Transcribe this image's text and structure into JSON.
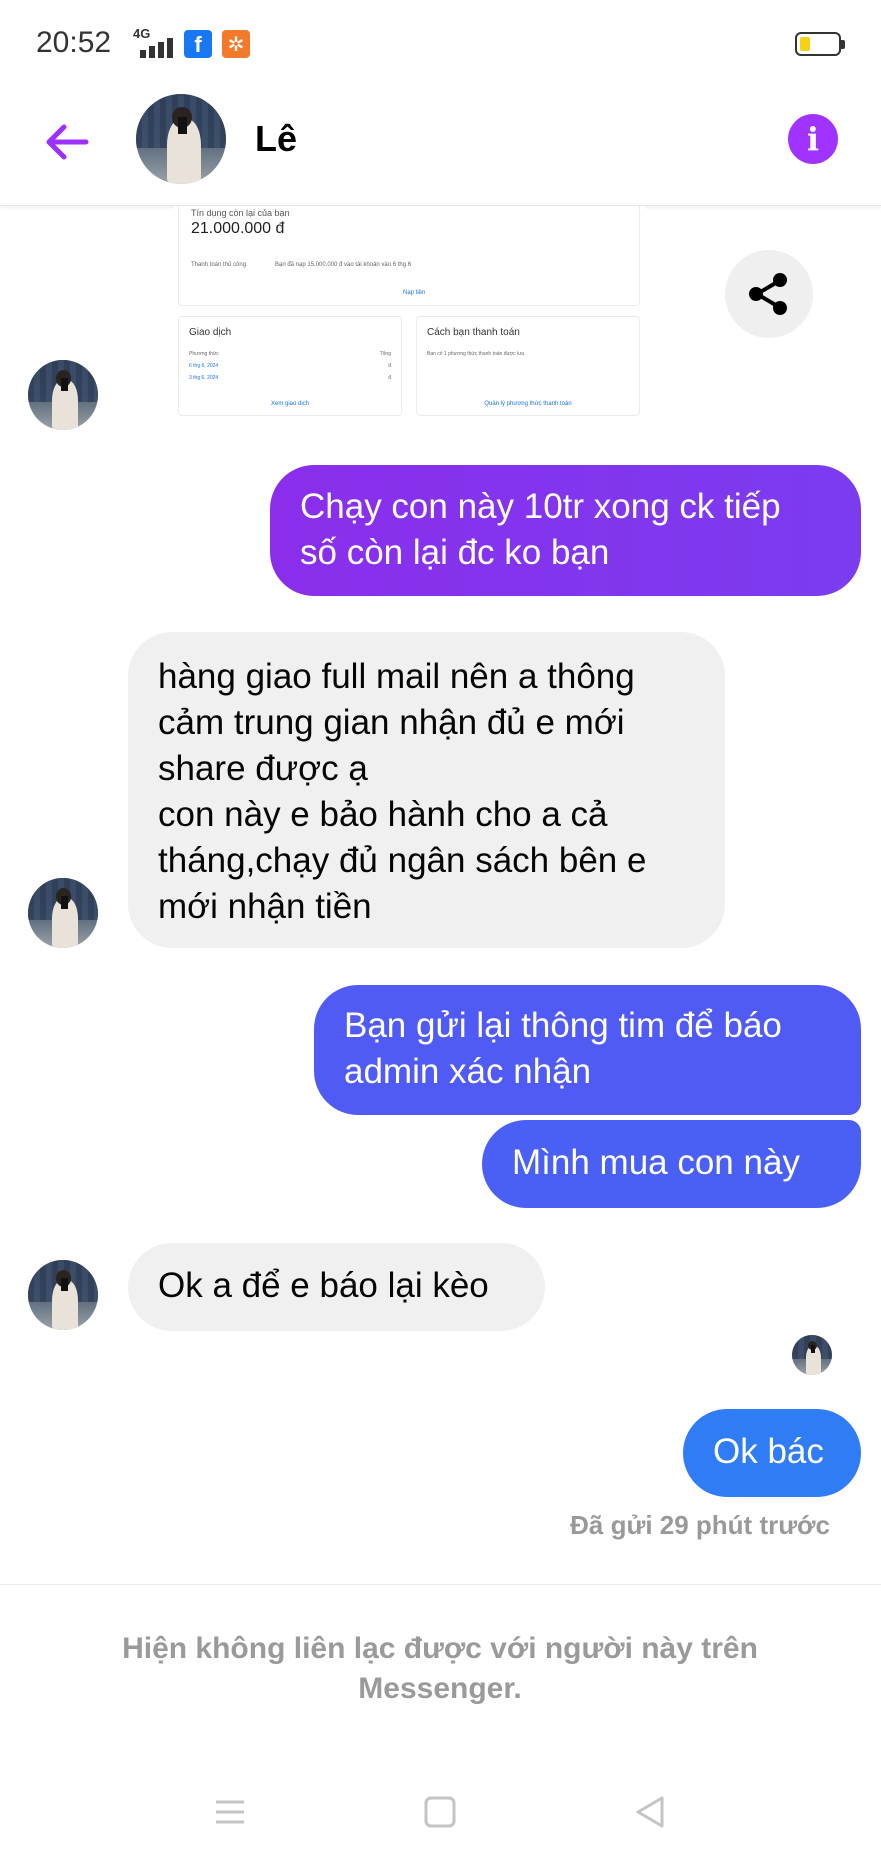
{
  "status_bar": {
    "time": "20:52",
    "network": "4G",
    "app_icons": [
      "facebook-icon",
      "notification-app-icon"
    ],
    "battery_level": 0.2
  },
  "header": {
    "contact_name": "Lê",
    "back_icon": "arrow-left-icon",
    "info_icon": "info-icon",
    "accent_color": "#a033ff"
  },
  "shared_card": {
    "credit_label": "Tín dụng còn lại của bạn",
    "credit_value": "21.000.000 đ",
    "note_left": "Thanh toán thủ công",
    "note_right": "Bạn đã nạp 15.000.000 đ vào tài khoản vào 6 thg 6",
    "top_link": "Nạp tiền",
    "transactions": {
      "title": "Giao dịch",
      "col_date": "Phương thức",
      "col_total": "Tổng",
      "rows": [
        {
          "date": "6 thg 6, 2024",
          "total": "đ"
        },
        {
          "date": "3 thg 6, 2024",
          "total": "đ"
        }
      ],
      "link": "Xem giao dịch"
    },
    "payment_methods": {
      "title": "Cách bạn thanh toán",
      "note": "Bạn có 1 phương thức thanh toán được lưu",
      "link": "Quản lý phương thức thanh toán"
    }
  },
  "share_icon": "share-icon",
  "messages": [
    {
      "direction": "sent",
      "text": "Chạy con này 10tr xong ck tiếp\nsố còn lại đc ko bạn"
    },
    {
      "direction": "received",
      "text": "hàng giao full mail nên a thông\ncảm trung gian nhận đủ e mới\nshare được ạ\ncon này e bảo hành cho a cả\ntháng,chạy đủ ngân sách bên e\nmới nhận tiền"
    },
    {
      "direction": "sent",
      "text": "Bạn gửi lại thông tim để báo\nadmin xác nhận"
    },
    {
      "direction": "sent",
      "text": "Mình mua con này"
    },
    {
      "direction": "received",
      "text": "Ok a để e báo lại kèo"
    },
    {
      "direction": "sent",
      "text": "Ok bác"
    }
  ],
  "sent_status": "Đã gửi 29 phút trước",
  "footer_note": "Hiện không liên lạc được với người này trên\nMessenger.",
  "nav": [
    "menu-icon",
    "home-square-icon",
    "back-triangle-icon"
  ]
}
